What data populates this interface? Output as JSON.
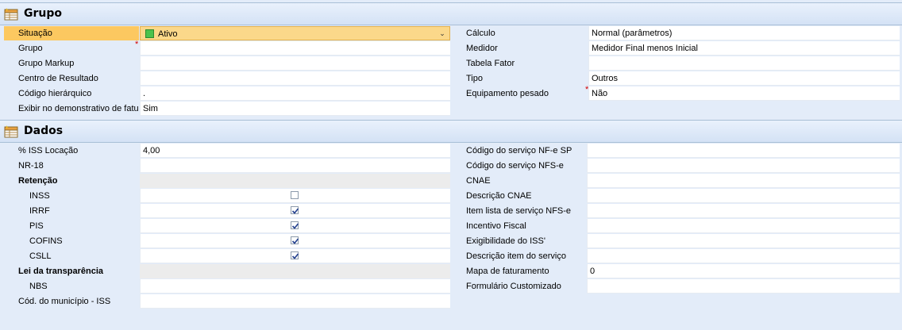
{
  "grupo": {
    "title": "Grupo",
    "left_rows": [
      {
        "label": "Situação",
        "value": "Ativo"
      },
      {
        "label": "Grupo",
        "value": ""
      },
      {
        "label": "Grupo Markup",
        "value": ""
      },
      {
        "label": "Centro de Resultado",
        "value": ""
      },
      {
        "label": "Código hierárquico",
        "value": "."
      },
      {
        "label": "Exibir no demonstrativo de fatu",
        "value": "Sim"
      }
    ],
    "right_rows": [
      {
        "label": "Cálculo",
        "value": "Normal (parâmetros)"
      },
      {
        "label": "Medidor",
        "value": "Medidor Final menos Inicial"
      },
      {
        "label": "Tabela Fator",
        "value": ""
      },
      {
        "label": "Tipo",
        "value": "Outros"
      },
      {
        "label": "Equipamento pesado",
        "value": "Não"
      }
    ]
  },
  "dados": {
    "title": "Dados",
    "left_rows": [
      {
        "label": "% ISS Locação",
        "value": "4,00"
      },
      {
        "label": "NR-18",
        "value": ""
      },
      {
        "label": "Retenção",
        "value": ""
      },
      {
        "label": "INSS",
        "checked": false
      },
      {
        "label": "IRRF",
        "checked": true
      },
      {
        "label": "PIS",
        "checked": true
      },
      {
        "label": "COFINS",
        "checked": true
      },
      {
        "label": "CSLL",
        "checked": true
      },
      {
        "label": "Lei da transparência",
        "value": ""
      },
      {
        "label": "NBS",
        "value": ""
      },
      {
        "label": "Cód. do município - ISS",
        "value": ""
      }
    ],
    "right_rows": [
      {
        "label": "Código do serviço NF-e SP",
        "value": ""
      },
      {
        "label": "Código do serviço NFS-e",
        "value": ""
      },
      {
        "label": "CNAE",
        "value": ""
      },
      {
        "label": "Descrição CNAE",
        "value": ""
      },
      {
        "label": "Item lista de serviço NFS-e",
        "value": ""
      },
      {
        "label": "Incentivo Fiscal",
        "value": ""
      },
      {
        "label": "Exigibilidade do ISS'",
        "value": ""
      },
      {
        "label": "Descrição item do serviço",
        "value": ""
      },
      {
        "label": "Mapa de faturamento",
        "value": "0"
      },
      {
        "label": "Formulário Customizado",
        "value": ""
      }
    ]
  },
  "colors": {
    "header_bg": "#d4e2f5",
    "selected": "#fbd88a",
    "required": "#d40000",
    "status_active": "#4cc24c"
  }
}
